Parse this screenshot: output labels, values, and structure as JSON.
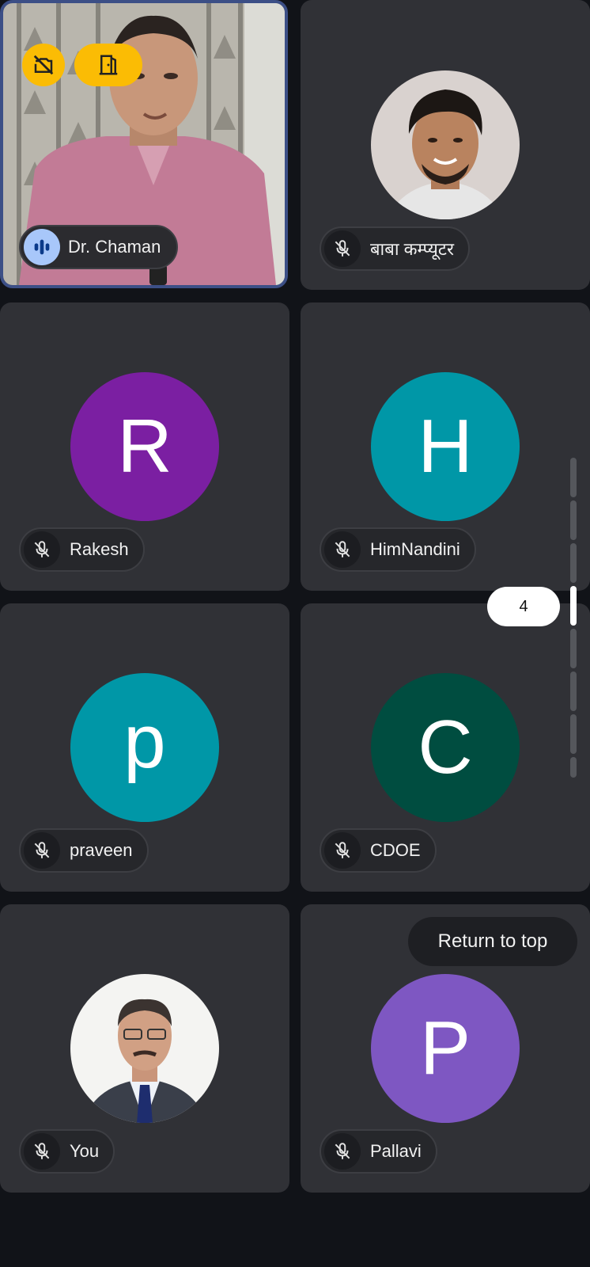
{
  "participants": [
    {
      "name": "Dr. Chaman",
      "tile": "video",
      "speaking": true
    },
    {
      "name": "बाबा कम्प्यूटर",
      "tile": "photo",
      "muted": true
    },
    {
      "name": "Rakesh",
      "initial": "R",
      "color": "#7b1fa2",
      "muted": true
    },
    {
      "name": "HimNandini",
      "initial": "H",
      "color": "#0097a7",
      "muted": true
    },
    {
      "name": "praveen",
      "initial": "p",
      "color": "#0097a7",
      "muted": true
    },
    {
      "name": "CDOE",
      "initial": "C",
      "color": "#004d40",
      "muted": true
    },
    {
      "name": "You",
      "tile": "photo",
      "muted": true
    },
    {
      "name": "Pallavi",
      "initial": "P",
      "color": "#7e57c2",
      "muted": true
    }
  ],
  "video_tile_icons": [
    "camera-off-icon",
    "exit-door-icon"
  ],
  "scroll": {
    "page_indicator": "4",
    "current_page": 4,
    "total_pages": 8
  },
  "return_to_top": "Return to top",
  "colors": {
    "accent_yellow": "#fbbc04",
    "tile_bg": "#303136",
    "speaking_blue": "#a8c7fa"
  }
}
